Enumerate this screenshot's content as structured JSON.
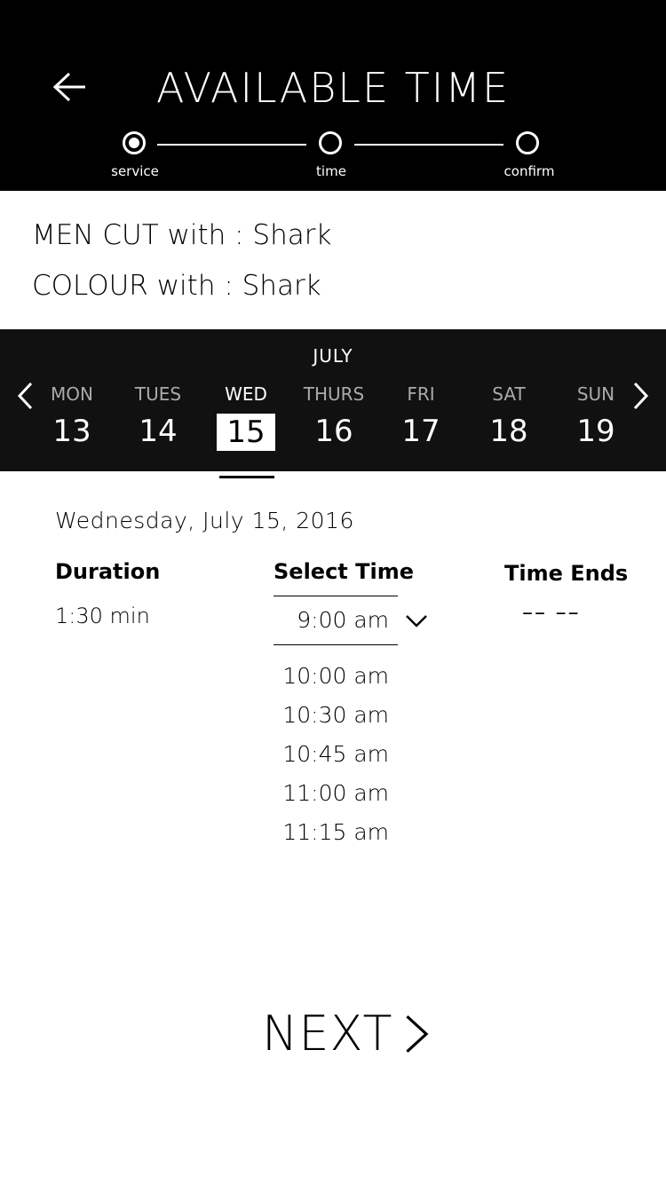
{
  "header": {
    "title": "AVAILABLE TIME",
    "steps": [
      {
        "label": "service",
        "active": true
      },
      {
        "label": "time",
        "active": false
      },
      {
        "label": "confirm",
        "active": false
      }
    ]
  },
  "services": [
    "MEN CUT with : Shark",
    "COLOUR with : Shark"
  ],
  "calendar": {
    "month": "JULY",
    "days": [
      {
        "name": "MON",
        "num": "13"
      },
      {
        "name": "TUES",
        "num": "14"
      },
      {
        "name": "WED",
        "num": "15"
      },
      {
        "name": "THURS",
        "num": "16"
      },
      {
        "name": "FRI",
        "num": "17"
      },
      {
        "name": "SAT",
        "num": "18"
      },
      {
        "name": "SUN",
        "num": "19"
      }
    ],
    "selected_index": 2
  },
  "details": {
    "full_date": "Wednesday, July 15, 2016",
    "duration_label": "Duration",
    "duration_value": "1:30 min",
    "select_time_label": "Select Time",
    "selected_time": "9:00 am",
    "time_ends_label": "Time Ends",
    "time_ends_value": "–– ––",
    "time_options": [
      "10:00 am",
      "10:30 am",
      "10:45 am",
      "11:00 am",
      "11:15 am"
    ]
  },
  "footer": {
    "next_label": "NEXT"
  },
  "colors": {
    "header_bg": "#000000",
    "week_bg": "#111111",
    "text": "#000000"
  }
}
